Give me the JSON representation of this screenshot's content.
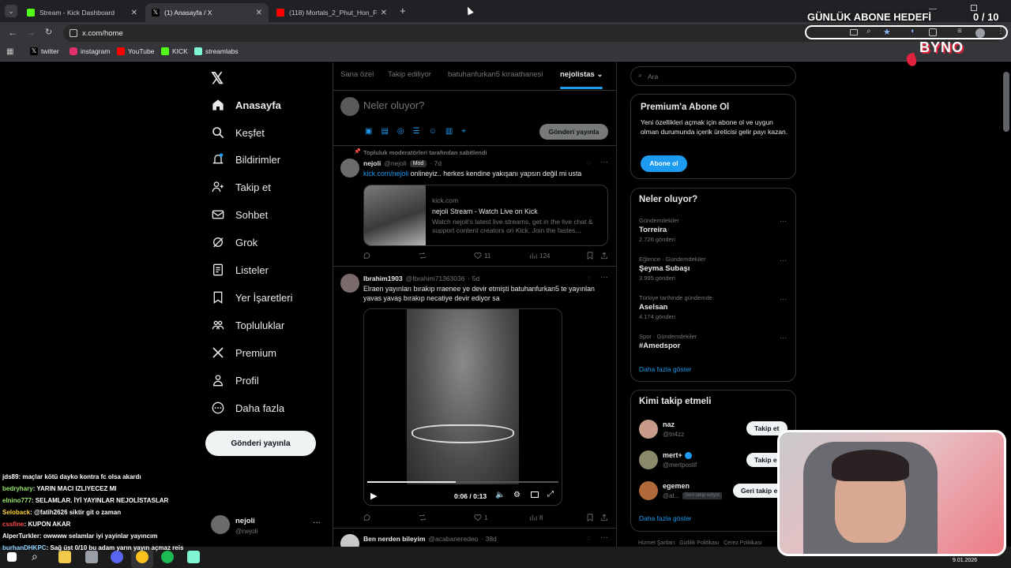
{
  "browser": {
    "tabs": [
      {
        "title": "Stream - Kick Dashboard",
        "color": "#53fc18"
      },
      {
        "title": "(1) Anasayfa / X",
        "color": "#ffffff"
      },
      {
        "title": "(118) Mortals_2_Phut_Hon_Fun",
        "color": "#ff0000"
      }
    ],
    "address": "x.com/home",
    "bookmarks": [
      {
        "label": "twitter"
      },
      {
        "label": "instagram"
      },
      {
        "label": "YouTube"
      },
      {
        "label": "KICK"
      },
      {
        "label": "streamlabs"
      }
    ]
  },
  "overlay": {
    "goal_label": "GÜNLÜK ABONE HEDEFİ",
    "goal_value": "0 / 10",
    "brand": "BYNO"
  },
  "sidebar": {
    "items": [
      {
        "label": "Anasayfa",
        "icon": "home-icon"
      },
      {
        "label": "Keşfet",
        "icon": "search-icon"
      },
      {
        "label": "Bildirimler",
        "icon": "bell-icon"
      },
      {
        "label": "Takip et",
        "icon": "follow-icon"
      },
      {
        "label": "Sohbet",
        "icon": "mail-icon"
      },
      {
        "label": "Grok",
        "icon": "grok-icon"
      },
      {
        "label": "Listeler",
        "icon": "list-icon"
      },
      {
        "label": "Yer İşaretleri",
        "icon": "bookmark-icon"
      },
      {
        "label": "Topluluklar",
        "icon": "community-icon"
      },
      {
        "label": "Premium",
        "icon": "x-icon"
      },
      {
        "label": "Profil",
        "icon": "profile-icon"
      },
      {
        "label": "Daha fazla",
        "icon": "more-icon"
      }
    ],
    "post_button": "Gönderi yayınla",
    "account": {
      "name": "nejoli",
      "handle": "@nejoli"
    }
  },
  "feed": {
    "tabs": [
      "Sana özel",
      "Takip ediliyor",
      "batuhanfurkan5 kıraathanesi",
      "nejolistas"
    ],
    "compose_placeholder": "Neler oluyor?",
    "compose_button": "Gönderi yayınla",
    "pinned_label": "Topluluk moderatörleri tarafından sabitlendi",
    "posts": [
      {
        "name": "nejoli",
        "handle": "@nejoli",
        "badge": "Mod",
        "time": "· 7d",
        "link": "kick.com/nejoli",
        "text": "onlineyiz.. herkes kendine yakışanı yapsın değil mi usta",
        "card": {
          "domain": "kick.com",
          "title": "nejoli Stream - Watch Live on Kick",
          "desc": "Watch nejoli's latest live streams, get in the live chat & support content creators on Kick. Join the fastes..."
        },
        "replies": "",
        "reposts": "",
        "likes": "11",
        "views": "124"
      },
      {
        "name": "Ibrahim1903",
        "handle": "@Ibrahim71363036",
        "time": "· 5d",
        "text": "Elraen yayınları bırakıp rraenee ye devir etmişti batuhanfurkan5 te yayınlan yavas yavaş bırakıp necatiye devir ediyor sa",
        "video_time": "0:06 / 0:13",
        "likes": "1",
        "views": "8"
      },
      {
        "name": "Ben nerden bileyim",
        "handle": "@acabaneredeo",
        "time": "· 38d"
      }
    ]
  },
  "right": {
    "search_placeholder": "Ara",
    "premium": {
      "title": "Premium'a Abone Ol",
      "text": "Yeni özellikleri açmak için abone ol ve uygun olman durumunda içerik üreticisi gelir payı kazan.",
      "button": "Abone ol"
    },
    "trends_title": "Neler oluyor?",
    "trends": [
      {
        "cat": "Gündemdekiler",
        "name": "Torreira",
        "count": "2.726 gönderi"
      },
      {
        "cat": "Eğlence · Gündemdekiler",
        "name": "Şeyma Subaşı",
        "count": "3.995 gönderi"
      },
      {
        "cat": "Türkiye tarihinde gündemde",
        "name": "Aselsan",
        "count": "4.174 gönderi"
      },
      {
        "cat": "Spor · Gündemdekiler",
        "name": "#Amedspor",
        "count": ""
      }
    ],
    "show_more": "Daha fazla göster",
    "who_title": "Kimi takip etmeli",
    "who": [
      {
        "name": "naz",
        "handle": "@tn4zz",
        "button": "Takip et"
      },
      {
        "name": "mert+",
        "handle": "@mertpostif",
        "button": "Takip e"
      },
      {
        "name": "egemen",
        "handle": "@al...",
        "tag": "Seni takip ediyor",
        "button": "Geri takip e"
      }
    ],
    "who_more": "Daha fazla göster",
    "footer": "Hizmet Şartları   Gizlilik Politikası   Çerez Politikası"
  },
  "chat": [
    {
      "user": "jds89",
      "color": "#ffffff",
      "msg": ": maçlar kötü dayko kontra fc olsa akardı"
    },
    {
      "user": "bedryhary",
      "color": "#9be870",
      "msg": ": YARIN MACI IZLIYECEZ MI"
    },
    {
      "user": "elnino777",
      "color": "#9be870",
      "msg": ": SELAMLAR. İYİ YAYINLAR NEJOLİSTASLAR"
    },
    {
      "user": "Seloback",
      "color": "#ffd23c",
      "msg": ": @fatih2626 siktir git o zaman"
    },
    {
      "user": "cssfine",
      "color": "#ff4b4b",
      "msg": ": KUPON AKAR"
    },
    {
      "user": "AlperTurkler",
      "color": "#ffffff",
      "msg": ": owwww selamlar iyi yayinlar yayıncım"
    },
    {
      "user": "burhanDHKPC",
      "color": "#8fd3ff",
      "msg": ": Sağ üst 0/10 bu adam yarın yayın açmaz reis"
    }
  ],
  "taskbar": {
    "date": "9.01.2026"
  }
}
